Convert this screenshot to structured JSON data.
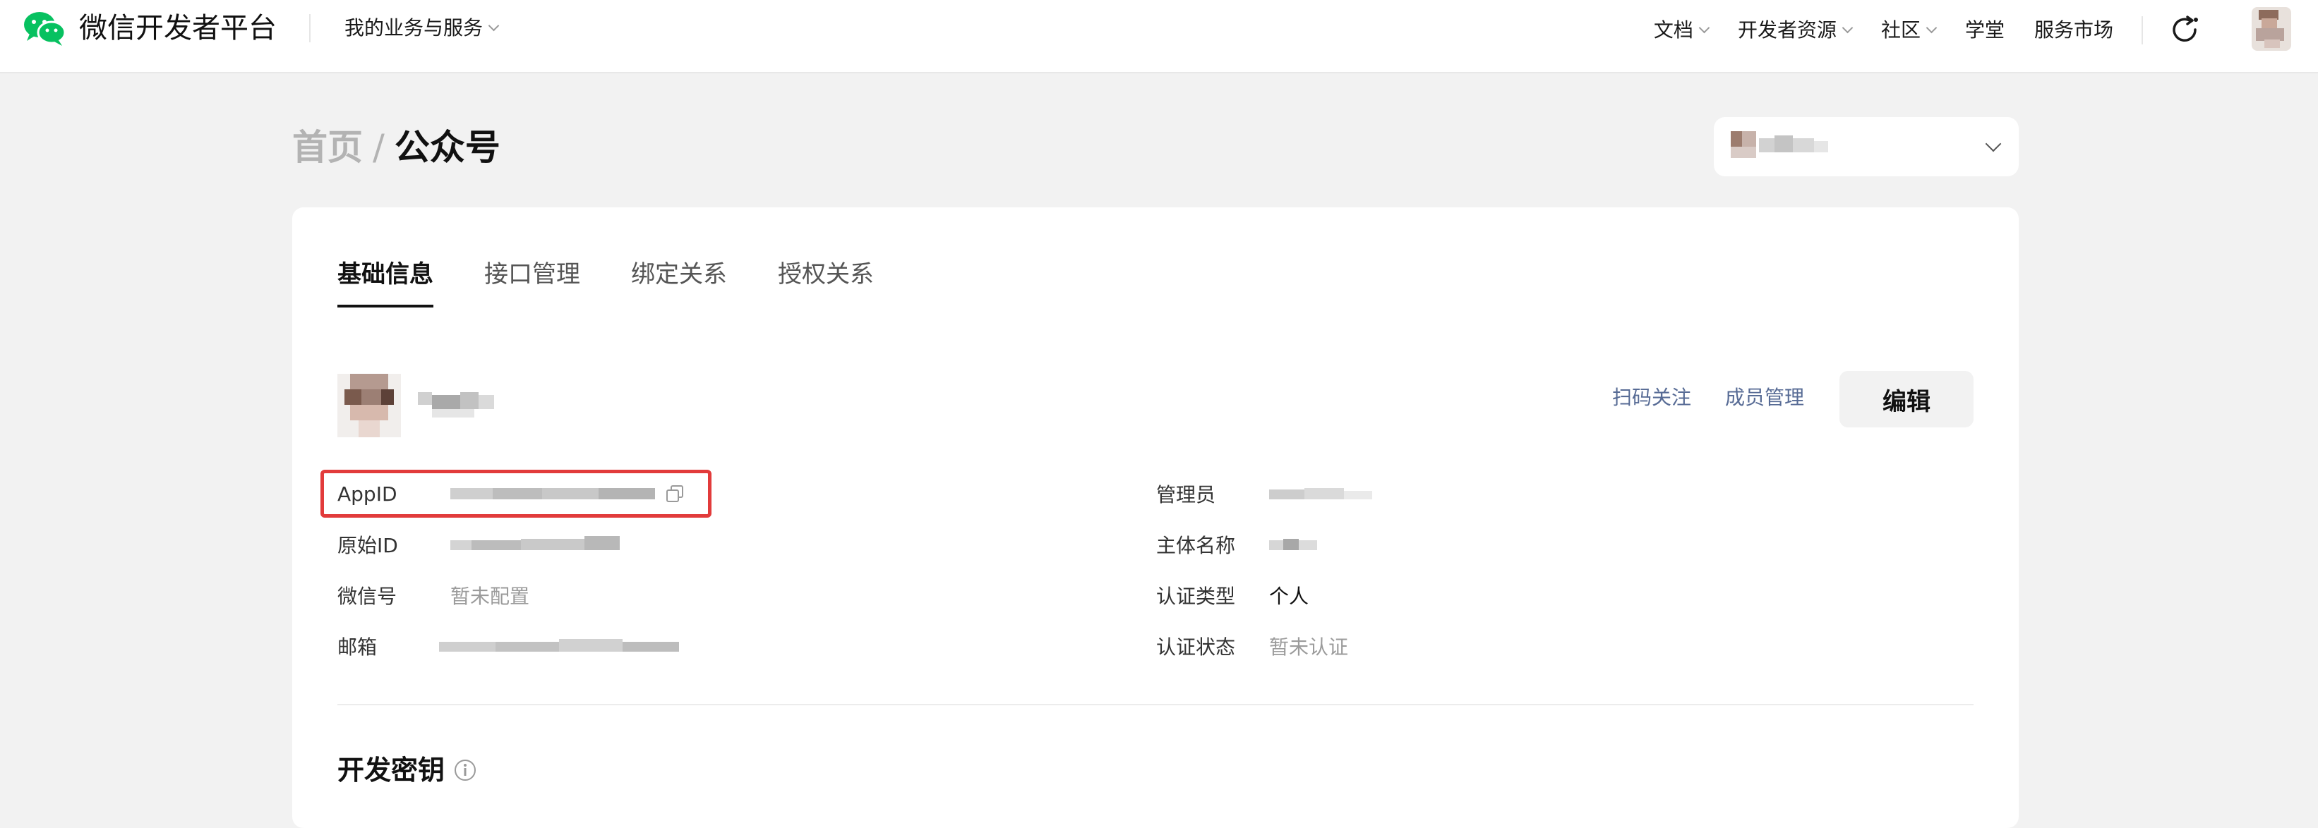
{
  "topbar": {
    "logo_text": "微信开发者平台",
    "biz_menu": "我的业务与服务",
    "nav": {
      "docs": "文档",
      "dev_resources": "开发者资源",
      "community": "社区",
      "academy": "学堂",
      "market": "服务市场"
    }
  },
  "breadcrumb": {
    "home": "首页",
    "separator": "/",
    "current": "公众号"
  },
  "tabs": [
    "基础信息",
    "接口管理",
    "绑定关系",
    "授权关系"
  ],
  "profile": {
    "scan_follow": "扫码关注",
    "member_manage": "成员管理",
    "edit": "编辑"
  },
  "info": {
    "appid_label": "AppID",
    "original_id_label": "原始ID",
    "wechat_id_label": "微信号",
    "wechat_id_value": "暂未配置",
    "email_label": "邮箱",
    "admin_label": "管理员",
    "entity_label": "主体名称",
    "cert_type_label": "认证类型",
    "cert_type_value": "个人",
    "cert_status_label": "认证状态",
    "cert_status_value": "暂未认证"
  },
  "section": {
    "dev_key_title": "开发密钥"
  },
  "colors": {
    "accent_link": "#576b95",
    "highlight": "#e23b3b",
    "wechat_green": "#07c160"
  }
}
